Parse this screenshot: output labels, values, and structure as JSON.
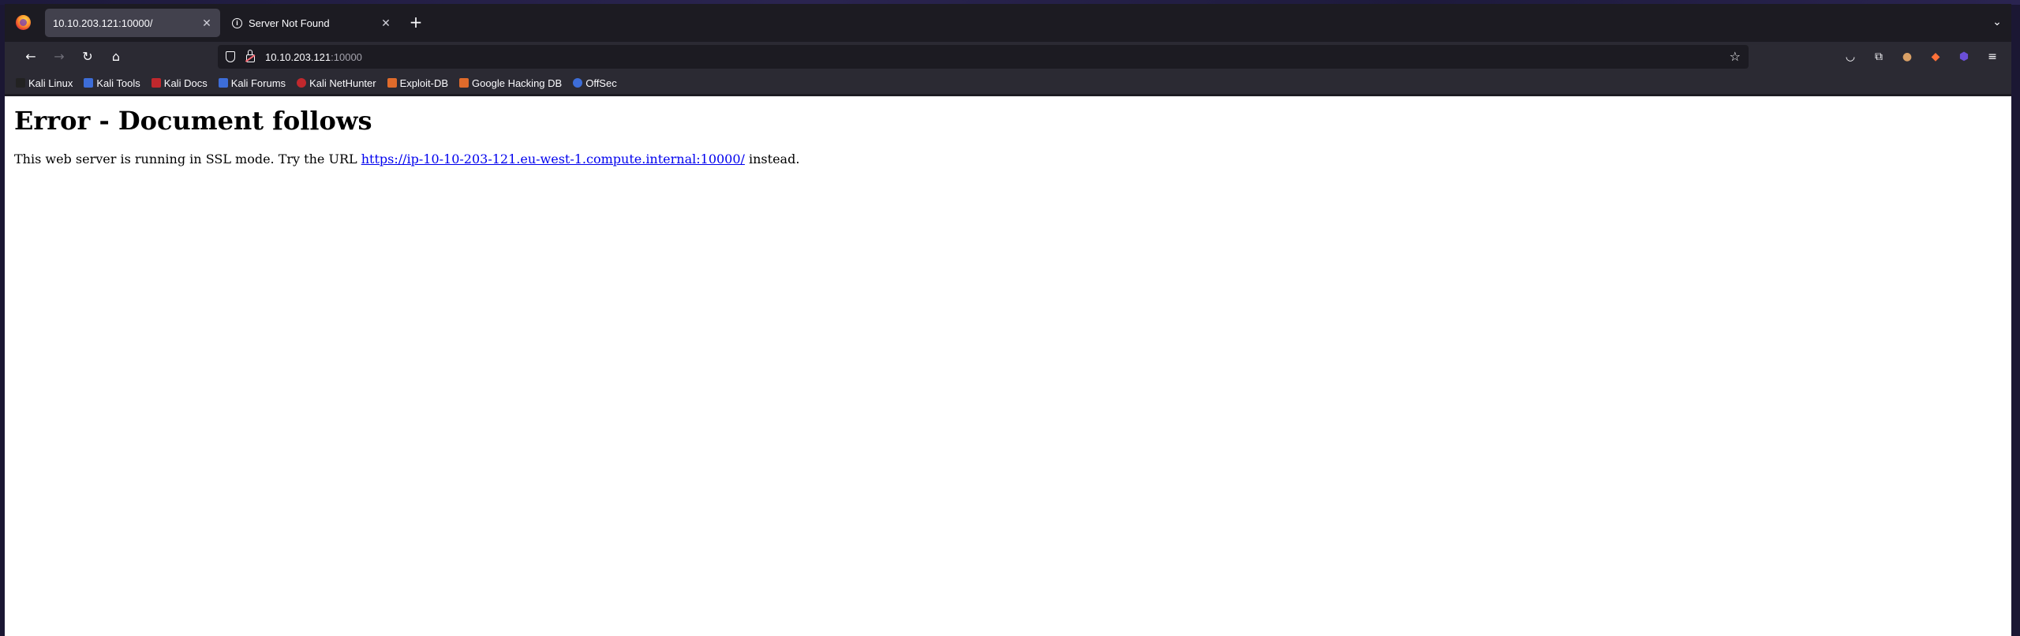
{
  "tabs": [
    {
      "title": "10.10.203.121:10000/",
      "active": true
    },
    {
      "title": "Server Not Found",
      "active": false
    }
  ],
  "url": {
    "host": "10.10.203.121",
    "port": ":10000"
  },
  "bookmarks": [
    {
      "label": "Kali Linux",
      "color": "#3d6dd8"
    },
    {
      "label": "Kali Tools",
      "color": "#3d6dd8"
    },
    {
      "label": "Kali Docs",
      "color": "#c0282d"
    },
    {
      "label": "Kali Forums",
      "color": "#3d6dd8"
    },
    {
      "label": "Kali NetHunter",
      "color": "#c0282d"
    },
    {
      "label": "Exploit-DB",
      "color": "#e06b2b"
    },
    {
      "label": "Google Hacking DB",
      "color": "#e06b2b"
    },
    {
      "label": "OffSec",
      "color": "#3d6dd8"
    }
  ],
  "page": {
    "heading": "Error - Document follows",
    "text_before": "This web server is running in SSL mode. Try the URL ",
    "link": "https://ip-10-10-203-121.eu-west-1.compute.internal:10000/",
    "text_after": " instead."
  }
}
